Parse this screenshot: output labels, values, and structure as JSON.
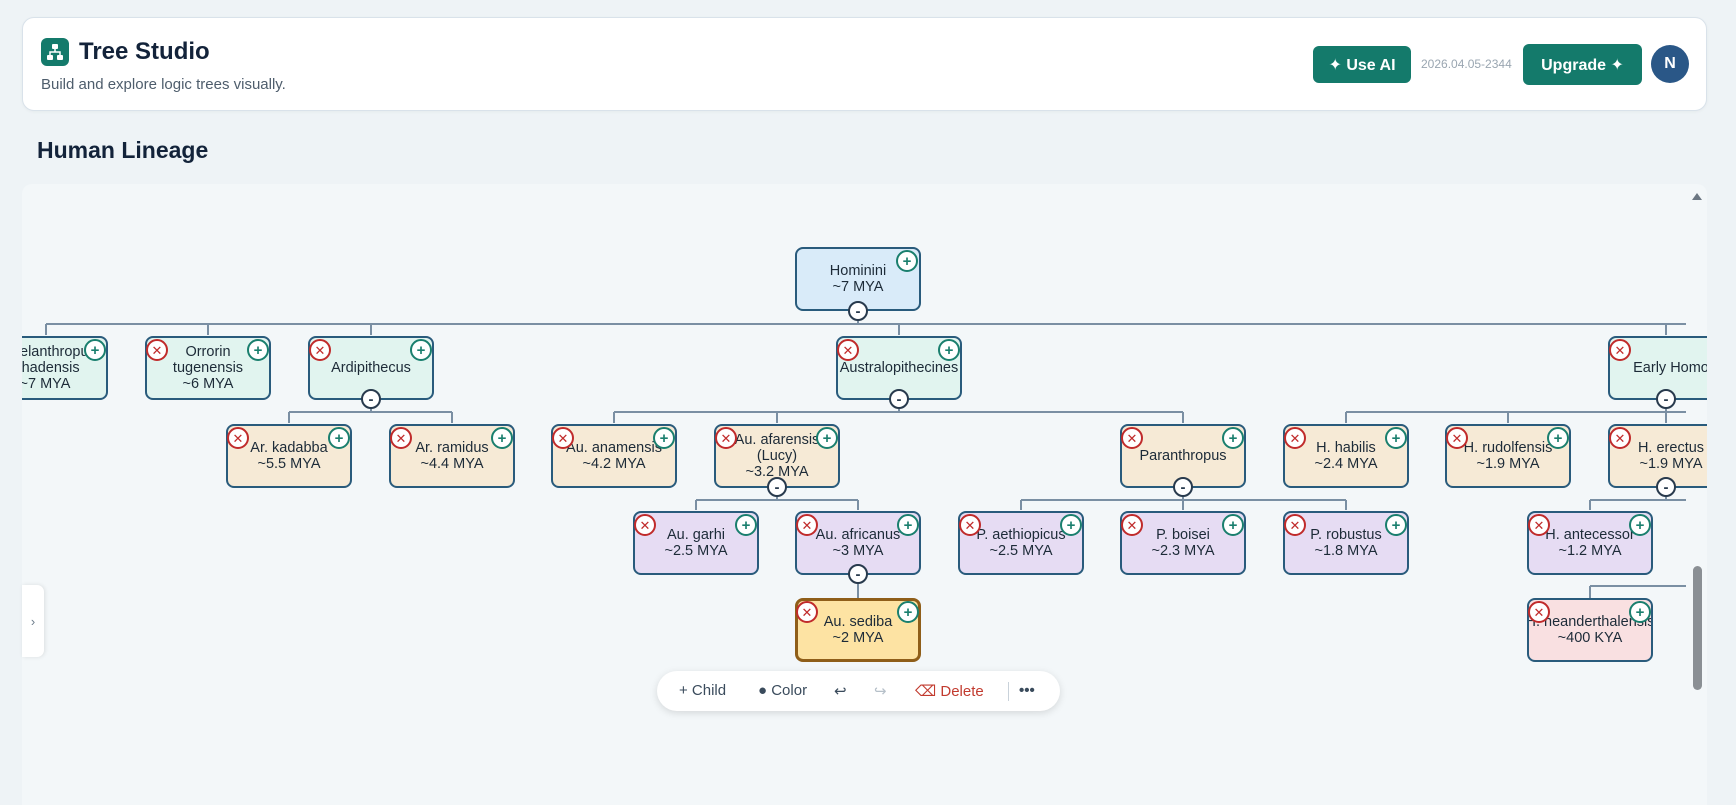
{
  "app": {
    "title": "Tree Studio",
    "subtitle": "Build and explore logic trees visually.",
    "use_ai_label": "✦ Use AI",
    "version": "2026.04.05-2344",
    "upgrade_label": "Upgrade ✦",
    "avatar_initial": "N"
  },
  "tree": {
    "title": "Human Lineage",
    "nodes": [
      {
        "id": "hominini",
        "line1": "Hominini",
        "line2": "~7 MYA",
        "color": "blue",
        "deletable": false,
        "collapse": true
      },
      {
        "id": "sahelanthropus",
        "line1": "Sahelanthropus",
        "line2": "tchadensis",
        "line3": "~7 MYA",
        "color": "green",
        "deletable": false,
        "collapse": false
      },
      {
        "id": "orrorin",
        "line1": "Orrorin",
        "line2": "tugenensis",
        "line3": "~6 MYA",
        "color": "green",
        "deletable": true,
        "collapse": false
      },
      {
        "id": "ardipithecus",
        "line1": "Ardipithecus",
        "color": "green",
        "deletable": true,
        "collapse": true
      },
      {
        "id": "australopithecines",
        "line1": "Australopithecines",
        "color": "green",
        "deletable": true,
        "collapse": true
      },
      {
        "id": "early-homo",
        "line1": "Early Homo",
        "color": "green",
        "deletable": true,
        "collapse": true
      },
      {
        "id": "ar-kadabba",
        "line1": "Ar. kadabba",
        "line2": "~5.5 MYA",
        "color": "tan",
        "deletable": true,
        "collapse": false
      },
      {
        "id": "ar-ramidus",
        "line1": "Ar. ramidus",
        "line2": "~4.4 MYA",
        "color": "tan",
        "deletable": true,
        "collapse": false
      },
      {
        "id": "au-anamensis",
        "line1": "Au. anamensis",
        "line2": "~4.2 MYA",
        "color": "tan",
        "deletable": true,
        "collapse": false
      },
      {
        "id": "au-afarensis",
        "line1": "Au. afarensis",
        "line2": "(Lucy)",
        "line3": "~3.2 MYA",
        "color": "tan",
        "deletable": true,
        "collapse": true
      },
      {
        "id": "paranthropus",
        "line1": "Paranthropus",
        "color": "tan",
        "deletable": true,
        "collapse": true
      },
      {
        "id": "h-habilis",
        "line1": "H. habilis",
        "line2": "~2.4 MYA",
        "color": "tan",
        "deletable": true,
        "collapse": false
      },
      {
        "id": "h-rudolfensis",
        "line1": "H. rudolfensis",
        "line2": "~1.9 MYA",
        "color": "tan",
        "deletable": true,
        "collapse": false
      },
      {
        "id": "h-erectus",
        "line1": "H. erectus",
        "line2": "~1.9 MYA",
        "color": "tan",
        "deletable": true,
        "collapse": true
      },
      {
        "id": "au-garhi",
        "line1": "Au. garhi",
        "line2": "~2.5 MYA",
        "color": "purple",
        "deletable": true,
        "collapse": false
      },
      {
        "id": "au-africanus",
        "line1": "Au. africanus",
        "line2": "~3 MYA",
        "color": "purple",
        "deletable": true,
        "collapse": true
      },
      {
        "id": "p-aethiopicus",
        "line1": "P. aethiopicus",
        "line2": "~2.5 MYA",
        "color": "purple",
        "deletable": true,
        "collapse": false
      },
      {
        "id": "p-boisei",
        "line1": "P. boisei",
        "line2": "~2.3 MYA",
        "color": "purple",
        "deletable": true,
        "collapse": false
      },
      {
        "id": "p-robustus",
        "line1": "P. robustus",
        "line2": "~1.8 MYA",
        "color": "purple",
        "deletable": true,
        "collapse": false
      },
      {
        "id": "h-antecessor",
        "line1": "H. antecessor",
        "line2": "~1.2 MYA",
        "color": "purple",
        "deletable": true,
        "collapse": false
      },
      {
        "id": "au-sediba",
        "line1": "Au. sediba",
        "line2": "~2 MYA",
        "color": "sel",
        "deletable": true,
        "collapse": false,
        "selected": true
      },
      {
        "id": "h-neanderthalensis",
        "line1": "H. neanderthalensis",
        "line2": "~400 KYA",
        "color": "red",
        "deletable": true,
        "collapse": false
      }
    ]
  },
  "toolbar": {
    "child_label": "+ Child",
    "color_label": "● Color",
    "undo_label": "↩",
    "redo_label": "↪",
    "delete_label": "⌫ Delete",
    "more_label": "•••"
  },
  "sidebar": {
    "toggle_label": "›"
  },
  "colors": {
    "accent": "#147a6b",
    "node_border": "#295b7c",
    "selected_border": "#8f5e19",
    "delete": "#c02b2b"
  }
}
